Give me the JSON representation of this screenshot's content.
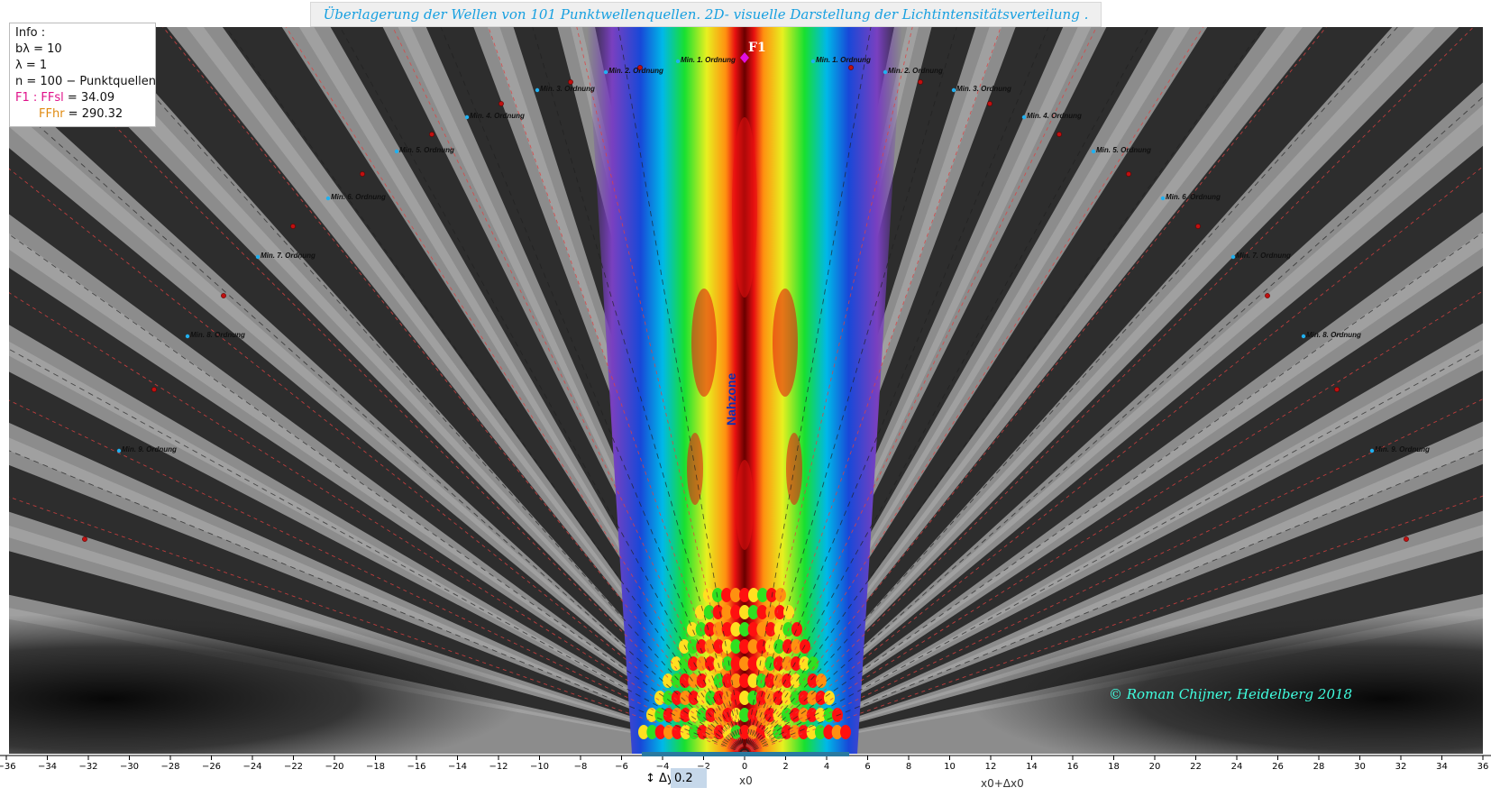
{
  "title": "Überlagerung der Wellen von 101 Punktwellenquellen. 2D-  visuelle Darstellung der Lichtintensitätsverteilung .",
  "info": {
    "line1": "Info :",
    "line2": "bλ = 10",
    "line3": "λ  = 1",
    "line4": "n = 100 − Punktquellen",
    "line5_label": "F1 : FFsl",
    "line5_value": " = 34.09",
    "line6_label": "FFhr",
    "line6_value": " = 290.32"
  },
  "near_zone_label": "Nahzone",
  "focus_label": "F1",
  "copyright": "© Roman Chijner, Heidelberg 2018",
  "x_axis": {
    "ticks": [
      -36,
      -34,
      -32,
      -30,
      -28,
      -26,
      -24,
      -22,
      -20,
      -18,
      -16,
      -14,
      -12,
      -10,
      -8,
      -6,
      -4,
      -2,
      0,
      2,
      4,
      6,
      8,
      10,
      12,
      14,
      16,
      18,
      20,
      22,
      24,
      26,
      28,
      30,
      32,
      34,
      36
    ],
    "x0_label": "x0",
    "x0dx_label": "x0+Δx0"
  },
  "slider": {
    "label": "↕ Δy=",
    "value": "0.2"
  },
  "minima_labels": [
    "Min. 1. Ordnung",
    "Min. 2. Ordnung",
    "Min. 3. Ordnung",
    "Min. 4. Ordnung",
    "Min. 5. Ordnung",
    "Min. 6. Ordnung",
    "Min. 7. Ordnung",
    "Min. 8. Ordnung",
    "Min. 9. Ordnung"
  ],
  "colors": {
    "background_gray": "#8c8c8c",
    "dark_band": "#141414",
    "red_dash": "#e04040",
    "black_dash": "#202020",
    "label_blue": "#18a0e0",
    "copyright": "#40ffe0",
    "focus_marker": "#e010e0",
    "source_bar": "#2a7aa0"
  }
}
